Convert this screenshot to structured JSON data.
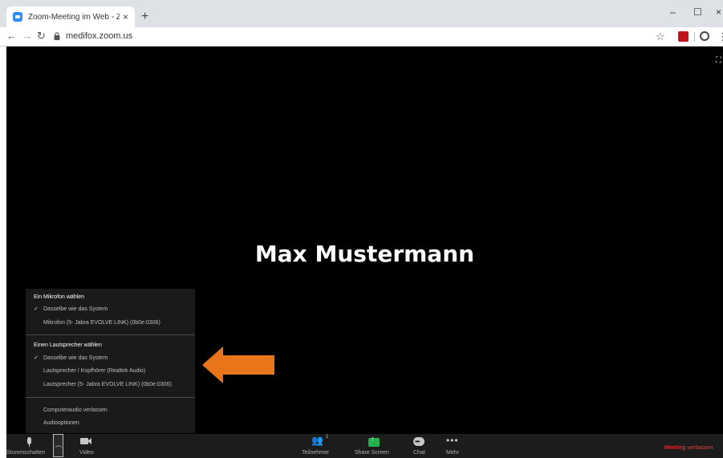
{
  "browser": {
    "tab_title": "Zoom-Meeting im Web - Zoom",
    "tab_close": "×",
    "new_tab": "+",
    "url": "medifox.zoom.us",
    "window_controls": {
      "minimize": "–",
      "maximize": "☐",
      "close": "×"
    }
  },
  "meeting": {
    "participant_name": "Max Mustermann",
    "audio_menu": {
      "mic_header": "Ein Mikrofon wählen",
      "mic_items": [
        {
          "label": "Dasselbe wie das System",
          "checked": true
        },
        {
          "label": "Mikrofon (5- Jabra EVOLVE LINK) (0b0e:0306)",
          "checked": false
        }
      ],
      "speaker_header": "Einen Lautsprecher wählen",
      "speaker_items": [
        {
          "label": "Dasselbe wie das System",
          "checked": true
        },
        {
          "label": "Lautsprecher / Kopfhörer (Realtek Audio)",
          "checked": false
        },
        {
          "label": "Lautsprecher (5- Jabra EVOLVE LINK) (0b0e:0306)",
          "checked": false
        }
      ],
      "leave_audio": "Computeraudio verlassen",
      "audio_options": "Audiooptionen",
      "check_glyph": "✓"
    },
    "toolbar": {
      "mute": "Stummschalten",
      "video": "Video",
      "participants": "Teilnehmer",
      "participant_count": "1",
      "share": "Share Screen",
      "chat": "Chat",
      "more": "Mehr",
      "leave": "Meeting verlassen"
    }
  },
  "colors": {
    "arrow": "#e8751a",
    "leave": "#e02828",
    "share": "#23b14d"
  }
}
